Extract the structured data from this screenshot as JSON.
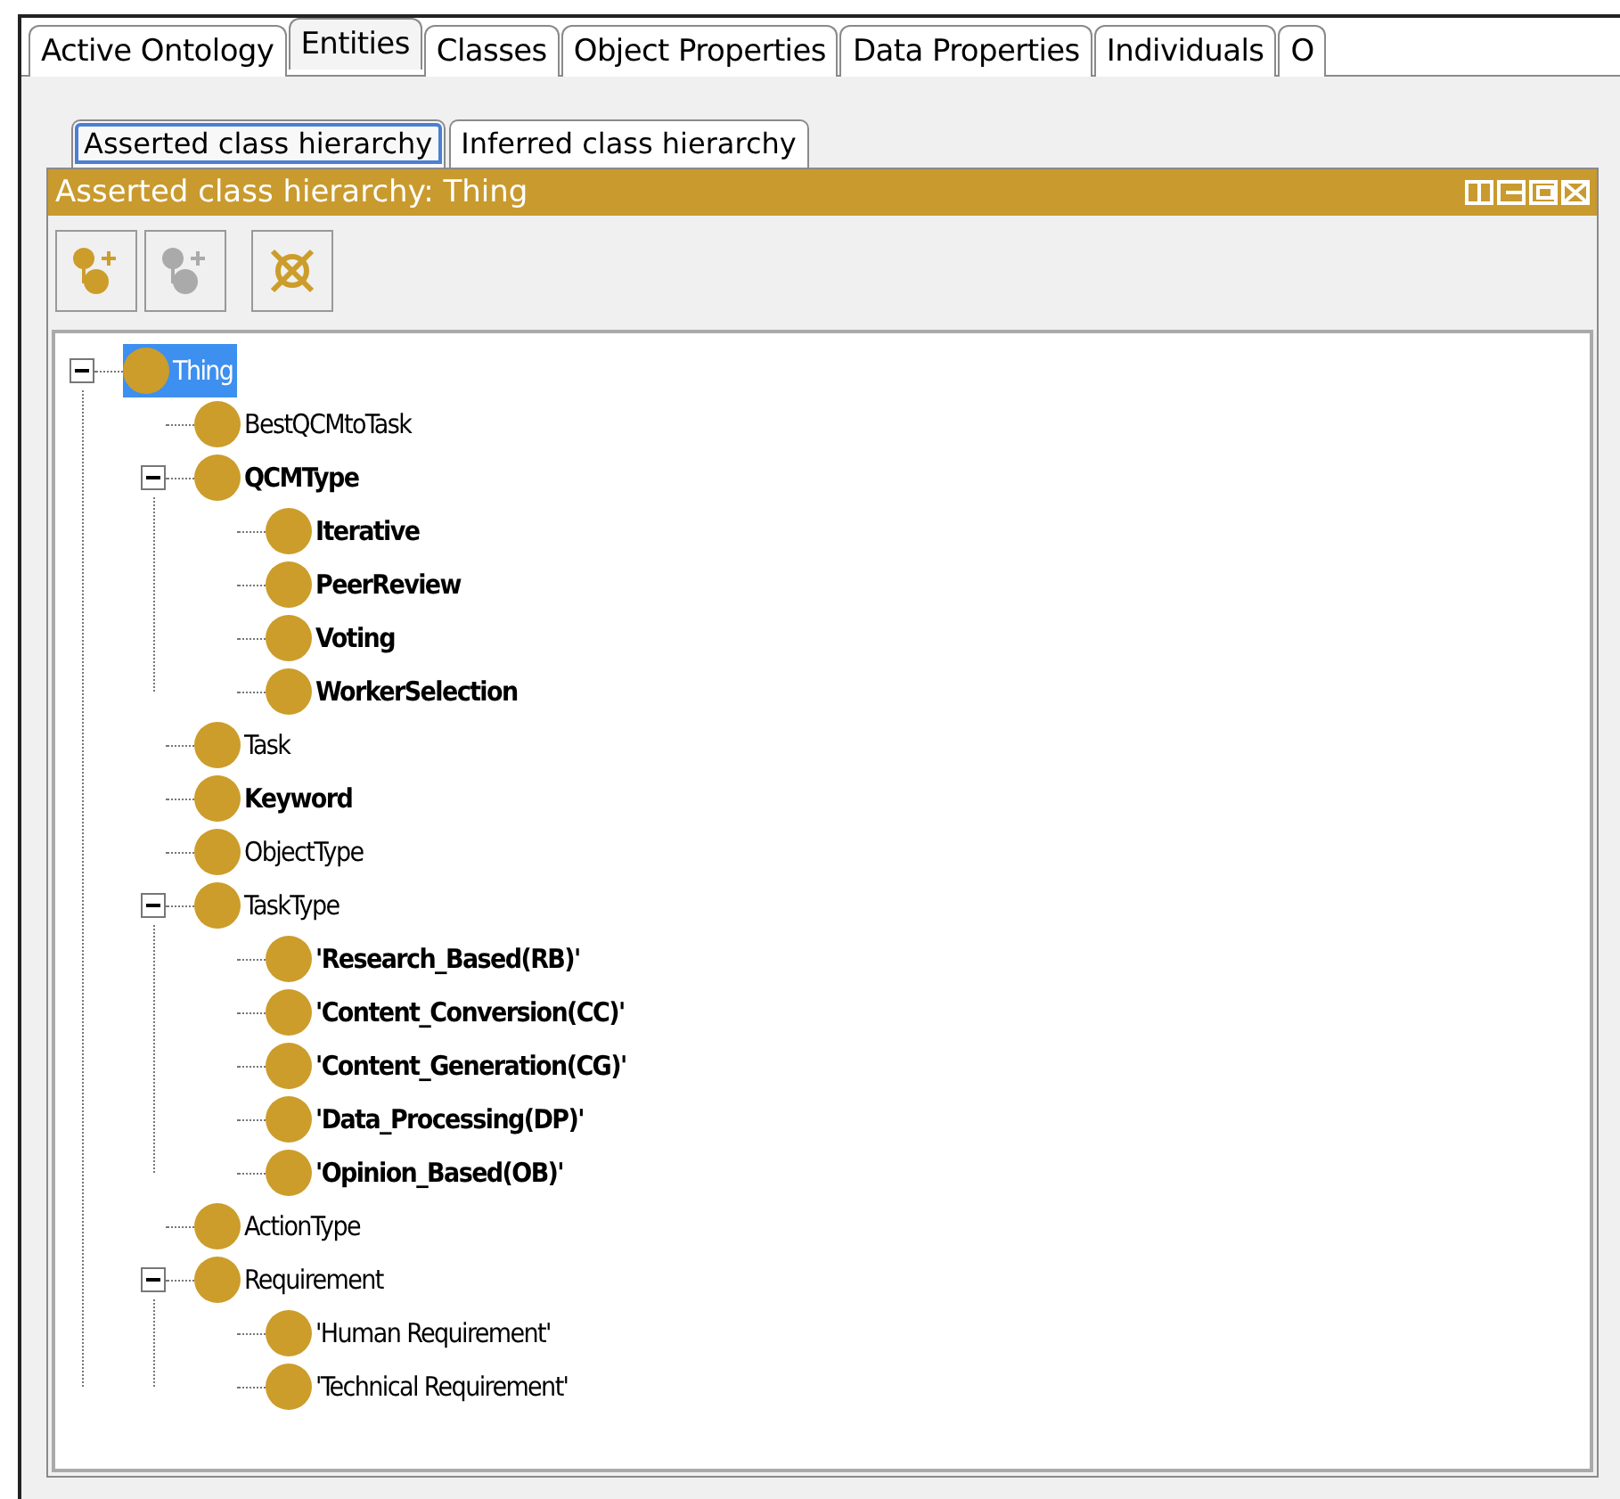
{
  "tabs": [
    {
      "label": "Active Ontology",
      "selected": false
    },
    {
      "label": "Entities",
      "selected": true
    },
    {
      "label": "Classes",
      "selected": false
    },
    {
      "label": "Object Properties",
      "selected": false
    },
    {
      "label": "Data Properties",
      "selected": false
    },
    {
      "label": "Individuals",
      "selected": false
    },
    {
      "label": "O",
      "selected": false
    }
  ],
  "view_tabs": [
    {
      "label": "Asserted class hierarchy",
      "selected": true
    },
    {
      "label": "Inferred class hierarchy",
      "selected": false
    }
  ],
  "panel": {
    "title": "Asserted class hierarchy: Thing",
    "toolbar": [
      {
        "kind": "add-subclass",
        "disabled": false
      },
      {
        "kind": "add-sibling",
        "disabled": true
      },
      {
        "kind": "delete",
        "disabled": false
      }
    ],
    "tree": [
      {
        "label": "Thing",
        "bold": false,
        "selected": true,
        "expanded": true,
        "children": [
          {
            "label": "BestQCMtoTask",
            "bold": false,
            "selected": false
          },
          {
            "label": "QCMType",
            "bold": true,
            "selected": false,
            "expanded": true,
            "children": [
              {
                "label": "Iterative",
                "bold": true,
                "selected": false
              },
              {
                "label": "PeerReview",
                "bold": true,
                "selected": false
              },
              {
                "label": "Voting",
                "bold": true,
                "selected": false
              },
              {
                "label": "WorkerSelection",
                "bold": true,
                "selected": false
              }
            ]
          },
          {
            "label": "Task",
            "bold": false,
            "selected": false
          },
          {
            "label": "Keyword",
            "bold": true,
            "selected": false
          },
          {
            "label": "ObjectType",
            "bold": false,
            "selected": false
          },
          {
            "label": "TaskType",
            "bold": false,
            "selected": false,
            "expanded": true,
            "children": [
              {
                "label": "'Research_Based(RB)'",
                "bold": true,
                "selected": false
              },
              {
                "label": "'Content_Conversion(CC)'",
                "bold": true,
                "selected": false
              },
              {
                "label": "'Content_Generation(CG)'",
                "bold": true,
                "selected": false
              },
              {
                "label": "'Data_Processing(DP)'",
                "bold": true,
                "selected": false
              },
              {
                "label": "'Opinion_Based(OB)'",
                "bold": true,
                "selected": false
              }
            ]
          },
          {
            "label": "ActionType",
            "bold": false,
            "selected": false
          },
          {
            "label": "Requirement",
            "bold": false,
            "selected": false,
            "expanded": true,
            "children": [
              {
                "label": "'Human Requirement'",
                "bold": false,
                "selected": false
              },
              {
                "label": "'Technical Requirement'",
                "bold": false,
                "selected": false
              }
            ]
          }
        ]
      }
    ]
  }
}
